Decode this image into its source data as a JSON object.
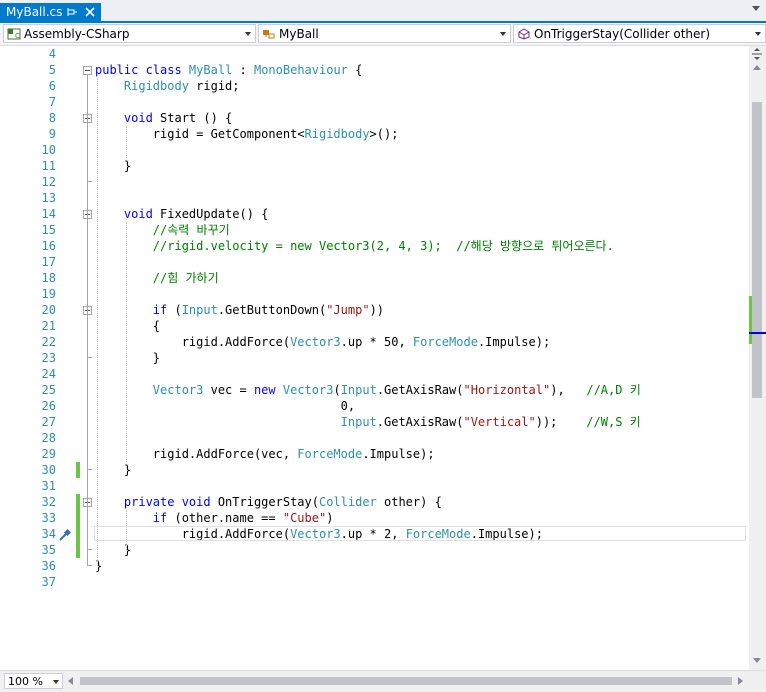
{
  "tab": {
    "filename": "MyBall.cs",
    "active_color": "#007acc"
  },
  "navbar": {
    "project": "Assembly-CSharp",
    "type": "MyBall",
    "member": "OnTriggerStay(Collider other)"
  },
  "editor": {
    "lines": [
      {
        "num": "4",
        "tokens": []
      },
      {
        "num": "5",
        "tokens": [
          {
            "t": "public class ",
            "c": "kw"
          },
          {
            "t": "MyBall",
            "c": "ty"
          },
          {
            "t": " : "
          },
          {
            "t": "MonoBehaviour",
            "c": "ty"
          },
          {
            "t": " {"
          }
        ]
      },
      {
        "num": "6",
        "tokens": [
          {
            "t": "    "
          },
          {
            "t": "Rigidbody",
            "c": "ty"
          },
          {
            "t": " rigid;"
          }
        ]
      },
      {
        "num": "7",
        "tokens": []
      },
      {
        "num": "8",
        "tokens": [
          {
            "t": "    "
          },
          {
            "t": "void",
            "c": "kw"
          },
          {
            "t": " Start () {"
          }
        ]
      },
      {
        "num": "9",
        "tokens": [
          {
            "t": "        rigid = GetComponent<"
          },
          {
            "t": "Rigidbody",
            "c": "ty"
          },
          {
            "t": ">();"
          }
        ]
      },
      {
        "num": "10",
        "tokens": []
      },
      {
        "num": "11",
        "tokens": [
          {
            "t": "    }"
          }
        ]
      },
      {
        "num": "12",
        "tokens": []
      },
      {
        "num": "13",
        "tokens": []
      },
      {
        "num": "14",
        "tokens": [
          {
            "t": "    "
          },
          {
            "t": "void",
            "c": "kw"
          },
          {
            "t": " FixedUpdate() {"
          }
        ]
      },
      {
        "num": "15",
        "tokens": [
          {
            "t": "        "
          },
          {
            "t": "//속력 바꾸기",
            "c": "cm"
          }
        ]
      },
      {
        "num": "16",
        "tokens": [
          {
            "t": "        "
          },
          {
            "t": "//rigid.velocity = new Vector3(2, 4, 3);  //해당 방향으로 튀어오른다.",
            "c": "cm"
          }
        ]
      },
      {
        "num": "17",
        "tokens": []
      },
      {
        "num": "18",
        "tokens": [
          {
            "t": "        "
          },
          {
            "t": "//힘 가하기",
            "c": "cm"
          }
        ]
      },
      {
        "num": "19",
        "tokens": []
      },
      {
        "num": "20",
        "tokens": [
          {
            "t": "        "
          },
          {
            "t": "if",
            "c": "kw"
          },
          {
            "t": " ("
          },
          {
            "t": "Input",
            "c": "ty"
          },
          {
            "t": ".GetButtonDown("
          },
          {
            "t": "\"Jump\"",
            "c": "st"
          },
          {
            "t": "))"
          }
        ]
      },
      {
        "num": "21",
        "tokens": [
          {
            "t": "        {"
          }
        ]
      },
      {
        "num": "22",
        "tokens": [
          {
            "t": "            rigid.AddForce("
          },
          {
            "t": "Vector3",
            "c": "ty"
          },
          {
            "t": ".up * 50, "
          },
          {
            "t": "ForceMode",
            "c": "ty"
          },
          {
            "t": ".Impulse);"
          }
        ]
      },
      {
        "num": "23",
        "tokens": [
          {
            "t": "        }"
          }
        ]
      },
      {
        "num": "24",
        "tokens": []
      },
      {
        "num": "25",
        "tokens": [
          {
            "t": "        "
          },
          {
            "t": "Vector3",
            "c": "ty"
          },
          {
            "t": " vec = "
          },
          {
            "t": "new",
            "c": "kw"
          },
          {
            "t": " "
          },
          {
            "t": "Vector3",
            "c": "ty"
          },
          {
            "t": "("
          },
          {
            "t": "Input",
            "c": "ty"
          },
          {
            "t": ".GetAxisRaw("
          },
          {
            "t": "\"Horizontal\"",
            "c": "st"
          },
          {
            "t": "),   "
          },
          {
            "t": "//A,D 키",
            "c": "cm"
          }
        ]
      },
      {
        "num": "26",
        "tokens": [
          {
            "t": "                                  0,"
          }
        ]
      },
      {
        "num": "27",
        "tokens": [
          {
            "t": "                                  "
          },
          {
            "t": "Input",
            "c": "ty"
          },
          {
            "t": ".GetAxisRaw("
          },
          {
            "t": "\"Vertical\"",
            "c": "st"
          },
          {
            "t": "));    "
          },
          {
            "t": "//W,S 키",
            "c": "cm"
          }
        ]
      },
      {
        "num": "28",
        "tokens": []
      },
      {
        "num": "29",
        "tokens": [
          {
            "t": "        rigid.AddForce(vec, "
          },
          {
            "t": "ForceMode",
            "c": "ty"
          },
          {
            "t": ".Impulse);"
          }
        ]
      },
      {
        "num": "30",
        "tokens": [
          {
            "t": "    }"
          }
        ]
      },
      {
        "num": "31",
        "tokens": []
      },
      {
        "num": "32",
        "tokens": [
          {
            "t": "    "
          },
          {
            "t": "private void",
            "c": "kw"
          },
          {
            "t": " OnTriggerStay("
          },
          {
            "t": "Collider",
            "c": "ty"
          },
          {
            "t": " other) {"
          }
        ]
      },
      {
        "num": "33",
        "tokens": [
          {
            "t": "        "
          },
          {
            "t": "if",
            "c": "kw"
          },
          {
            "t": " (other.name == "
          },
          {
            "t": "\"Cube\"",
            "c": "st"
          },
          {
            "t": ")"
          }
        ]
      },
      {
        "num": "34",
        "tokens": [
          {
            "t": "            rigid.AddForce("
          },
          {
            "t": "Vector3",
            "c": "ty"
          },
          {
            "t": ".up * 2, "
          },
          {
            "t": "ForceMode",
            "c": "ty"
          },
          {
            "t": ".Impulse);"
          }
        ]
      },
      {
        "num": "35",
        "tokens": [
          {
            "t": "    }"
          }
        ]
      },
      {
        "num": "36",
        "tokens": [
          {
            "t": "}"
          }
        ]
      },
      {
        "num": "37",
        "tokens": []
      }
    ],
    "colors": {
      "keyword": "#0000ff",
      "type": "#2b91af",
      "comment": "#008000",
      "string": "#a31515",
      "line_number": "#2b91af",
      "change_marker": "#6cc644"
    }
  },
  "status": {
    "zoom": "100 %"
  },
  "icons": [
    "pin-icon",
    "close-icon",
    "dropdown-arrow-icon",
    "csharp-project-icon",
    "class-icon",
    "method-icon",
    "quick-actions-icon",
    "splitter-icon"
  ]
}
